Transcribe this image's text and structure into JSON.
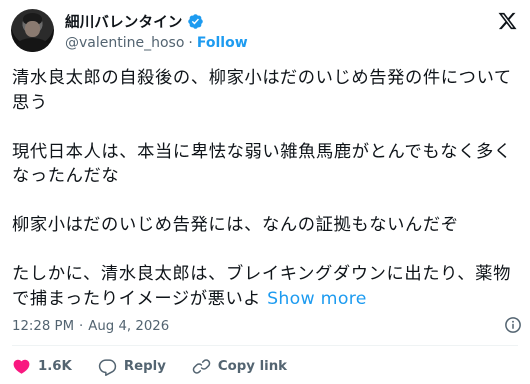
{
  "author": {
    "display_name": "細川バレンタイン",
    "handle": "@valentine_hoso",
    "separator": "·",
    "follow_label": "Follow"
  },
  "tweet": {
    "paragraphs": [
      "清水良太郎の自殺後の、柳家小はだのいじめ告発の件について思う",
      "現代日本人は、本当に卑怯な弱い雑魚馬鹿がとんでもなく多くなったんだな",
      "柳家小はだのいじめ告発には、なんの証拠もないんだぞ",
      "たしかに、清水良太郎は、ブレイキングダウンに出たり、薬物で捕まったりイメージが悪いよ"
    ],
    "show_more_label": "Show more",
    "time": "12:28 PM",
    "separator": "·",
    "date": "Aug 4, 2026"
  },
  "actions": {
    "like_count": "1.6K",
    "reply_label": "Reply",
    "copy_link_label": "Copy link"
  },
  "colors": {
    "accent": "#1d9bf0",
    "like": "#f91880",
    "muted": "#536471",
    "text": "#0f1419"
  },
  "icons": {
    "verified": "verified-badge-icon",
    "logo": "x-logo-icon",
    "info": "info-icon",
    "like": "heart-icon",
    "reply": "speech-bubble-icon",
    "copy_link": "link-icon"
  }
}
